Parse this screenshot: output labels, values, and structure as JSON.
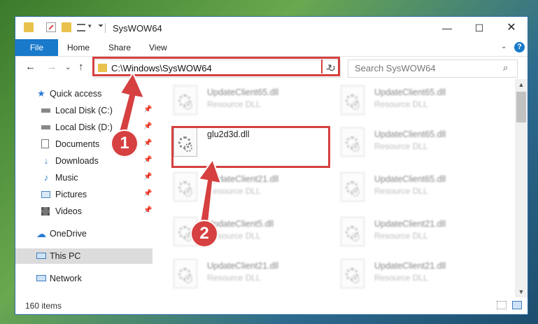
{
  "window": {
    "title": "SysWOW64",
    "controls": [
      "minimize-icon",
      "maximize-icon",
      "close-icon"
    ]
  },
  "quick_access_toolbar": [
    "folder-icon",
    "properties-icon",
    "new-folder-icon",
    "view-icon",
    "customize-dropdown-icon"
  ],
  "ribbon": {
    "file_label": "File",
    "tabs": [
      "Home",
      "Share",
      "View"
    ]
  },
  "address_bar": {
    "path": "C:\\Windows\\SysWOW64"
  },
  "search": {
    "placeholder": "Search SysWOW64"
  },
  "nav_pane": {
    "items": [
      {
        "label": "Quick access",
        "icon": "star-icon",
        "pinned": false
      },
      {
        "label": "Local Disk (C:)",
        "icon": "drive-icon",
        "pinned": true
      },
      {
        "label": "Local Disk (D:)",
        "icon": "drive-icon",
        "pinned": true
      },
      {
        "label": "Documents",
        "icon": "documents-icon",
        "pinned": true
      },
      {
        "label": "Downloads",
        "icon": "download-icon",
        "pinned": true
      },
      {
        "label": "Music",
        "icon": "music-icon",
        "pinned": true
      },
      {
        "label": "Pictures",
        "icon": "pictures-icon",
        "pinned": true
      },
      {
        "label": "Videos",
        "icon": "videos-icon",
        "pinned": true
      },
      {
        "label": "OneDrive",
        "icon": "cloud-icon",
        "pinned": false
      },
      {
        "label": "This PC",
        "icon": "computer-icon",
        "pinned": false,
        "selected": true
      },
      {
        "label": "Network",
        "icon": "network-icon",
        "pinned": false
      }
    ]
  },
  "files": [
    {
      "name": "UpdateClient65.dll",
      "type": "Resource DLL",
      "blurred": true
    },
    {
      "name": "UpdateClient65.dll",
      "type": "Resource DLL",
      "blurred": true
    },
    {
      "name": "glu2d3d.dll",
      "type": "",
      "blurred": false,
      "highlighted": true
    },
    {
      "name": "UpdateClient65.dll",
      "type": "Resource DLL",
      "blurred": true
    },
    {
      "name": "UpdateClient21.dll",
      "type": "Resource DLL",
      "blurred": true
    },
    {
      "name": "UpdateClient65.dll",
      "type": "Resource DLL",
      "blurred": true
    },
    {
      "name": "UpdateClient5.dll",
      "type": "Resource DLL",
      "blurred": true
    },
    {
      "name": "UpdateClient21.dll",
      "type": "Resource DLL",
      "blurred": true
    },
    {
      "name": "UpdateClient21.dll",
      "type": "Resource DLL",
      "blurred": true
    },
    {
      "name": "UpdateClient21.dll",
      "type": "Resource DLL",
      "blurred": true
    }
  ],
  "status_bar": {
    "item_count": "160 items"
  },
  "annotations": {
    "step1": "1",
    "step2": "2",
    "highlight_color": "#d64040"
  },
  "colors": {
    "accent": "#1979ca",
    "folder": "#e8c24c"
  }
}
